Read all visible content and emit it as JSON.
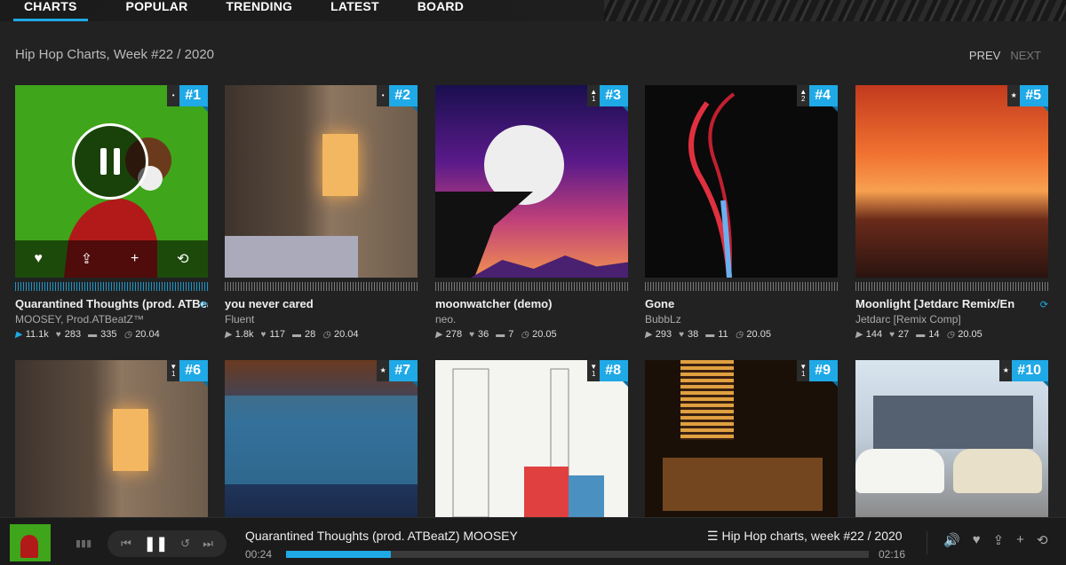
{
  "nav": {
    "tabs": [
      {
        "label": "CHARTS",
        "active": true
      },
      {
        "label": "POPULAR",
        "active": false
      },
      {
        "label": "TRENDING",
        "active": false
      },
      {
        "label": "LATEST",
        "active": false
      },
      {
        "label": "BOARD",
        "active": false
      }
    ]
  },
  "heading": "Hip Hop Charts, Week #22 / 2020",
  "pager": {
    "prev": "PREV",
    "next": "NEXT"
  },
  "cards": [
    {
      "rank": "#1",
      "move_symbol": "•",
      "move_count": "",
      "title": "Quarantined Thoughts (prod. ATBeatZ)",
      "artist": "MOOSEY, Prod.ATBeatZ™",
      "plays": "11.1k",
      "likes": "283",
      "comments": "335",
      "date": "20.04",
      "playing": true,
      "repeat_icon": true
    },
    {
      "rank": "#2",
      "move_symbol": "•",
      "move_count": "",
      "title": "you never cared",
      "artist": "Fluent",
      "plays": "1.8k",
      "likes": "117",
      "comments": "28",
      "date": "20.04",
      "playing": false,
      "repeat_icon": false
    },
    {
      "rank": "#3",
      "move_symbol": "▲",
      "move_count": "1",
      "title": "moonwatcher (demo)",
      "artist": "neo.",
      "plays": "278",
      "likes": "36",
      "comments": "7",
      "date": "20.05",
      "playing": false,
      "repeat_icon": false
    },
    {
      "rank": "#4",
      "move_symbol": "▲",
      "move_count": "2",
      "title": "Gone",
      "artist": "BubbLz",
      "plays": "293",
      "likes": "38",
      "comments": "11",
      "date": "20.05",
      "playing": false,
      "repeat_icon": false
    },
    {
      "rank": "#5",
      "move_symbol": "★",
      "move_count": "",
      "title": "Moonlight [Jetdarc Remix/En",
      "artist": "Jetdarc [Remix Comp]",
      "plays": "144",
      "likes": "27",
      "comments": "14",
      "date": "20.05",
      "playing": false,
      "repeat_icon": true
    },
    {
      "rank": "#6",
      "move_symbol": "▼",
      "move_count": "1",
      "title": "",
      "artist": "",
      "plays": "",
      "likes": "",
      "comments": "",
      "date": ""
    },
    {
      "rank": "#7",
      "move_symbol": "★",
      "move_count": "",
      "title": "",
      "artist": "",
      "plays": "",
      "likes": "",
      "comments": "",
      "date": ""
    },
    {
      "rank": "#8",
      "move_symbol": "▼",
      "move_count": "1",
      "title": "",
      "artist": "",
      "plays": "",
      "likes": "",
      "comments": "",
      "date": ""
    },
    {
      "rank": "#9",
      "move_symbol": "▼",
      "move_count": "1",
      "title": "",
      "artist": "",
      "plays": "",
      "likes": "",
      "comments": "",
      "date": ""
    },
    {
      "rank": "#10",
      "move_symbol": "★",
      "move_count": "",
      "title": "",
      "artist": "",
      "plays": "",
      "likes": "",
      "comments": "",
      "date": ""
    }
  ],
  "player": {
    "track": "Quarantined Thoughts (prod. ATBeatZ)  MOOSEY",
    "elapsed": "00:24",
    "duration": "02:16",
    "progress": 0.18,
    "playlist": "Hip Hop charts, week #22 / 2020"
  },
  "colors": {
    "accent": "#1fa9e6",
    "background": "#222222"
  }
}
